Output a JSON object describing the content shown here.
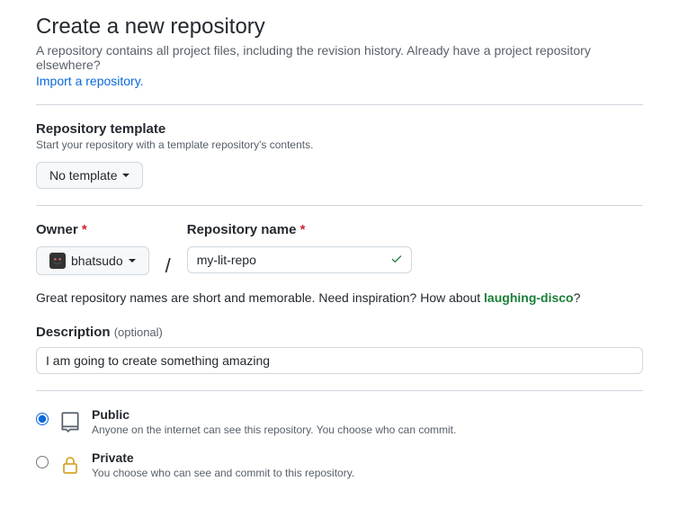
{
  "header": {
    "title": "Create a new repository",
    "subtitle": "A repository contains all project files, including the revision history. Already have a project repository elsewhere?",
    "import_link": "Import a repository."
  },
  "template": {
    "label": "Repository template",
    "sub": "Start your repository with a template repository's contents.",
    "selected": "No template"
  },
  "owner": {
    "label": "Owner",
    "selected": "bhatsudo"
  },
  "repo": {
    "label": "Repository name",
    "value": "my-lit-repo"
  },
  "helper": {
    "prefix": "Great repository names are short and memorable. Need inspiration? How about ",
    "suggestion": "laughing-disco",
    "suffix": "?"
  },
  "description": {
    "label": "Description",
    "optional": "(optional)",
    "value": "I am going to create something amazing"
  },
  "visibility": {
    "public": {
      "title": "Public",
      "desc": "Anyone on the internet can see this repository. You choose who can commit."
    },
    "private": {
      "title": "Private",
      "desc": "You choose who can see and commit to this repository."
    }
  }
}
